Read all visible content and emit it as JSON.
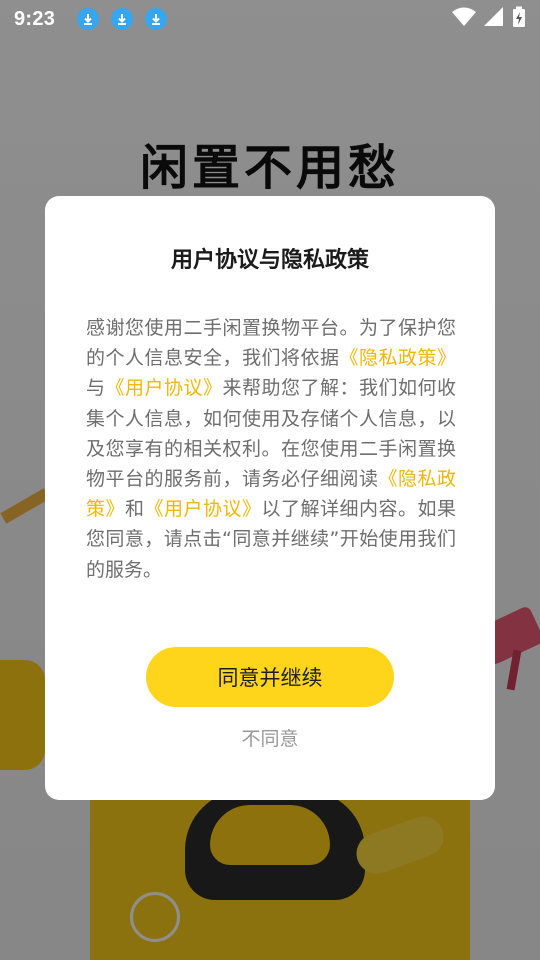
{
  "status_bar": {
    "time": "9:23",
    "left_icons": [
      "download-icon",
      "download-icon",
      "download-icon"
    ],
    "right_icons": [
      "wifi-icon",
      "signal-icon",
      "battery-charging-icon"
    ],
    "accent_color": "#35a6f0"
  },
  "background": {
    "headline": "闲置不用愁"
  },
  "dialog": {
    "title": "用户协议与隐私政策",
    "body": {
      "part1": "感谢您使用二手闲置换物平台。为了保护您的个人信息安全，我们将依据",
      "link_privacy_1": "《隐私政策》",
      "part2": "与",
      "link_terms_1": "《用户协议》",
      "part3": "来帮助您了解：我们如何收集个人信息，如何使用及存储个人信息，以及您享有的相关权利。在您使用二手闲置换物平台的服务前，请务必仔细阅读",
      "link_privacy_2": "《隐私政策》",
      "part4": "和",
      "link_terms_2": "《用户协议》",
      "part5": "以了解详细内容。如果您同意，请点击“同意并继续”开始使用我们的服务。"
    },
    "agree_label": "同意并继续",
    "disagree_label": "不同意",
    "link_color": "#f2b705",
    "button_color": "#fed51b"
  }
}
